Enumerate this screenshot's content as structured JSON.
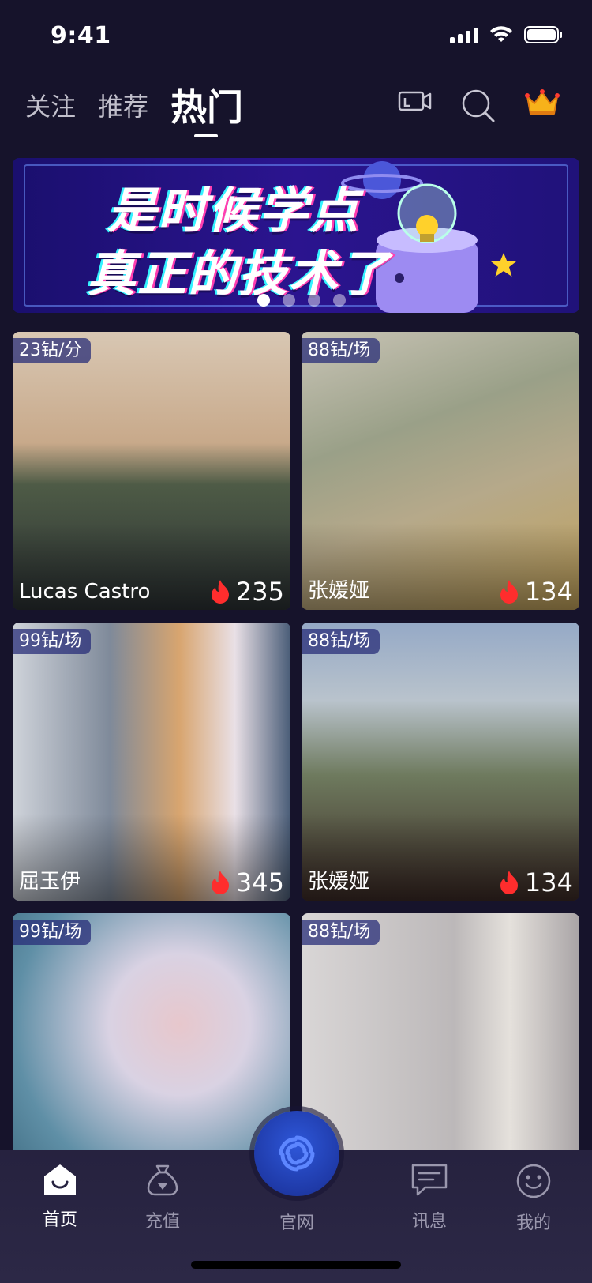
{
  "status_bar": {
    "time": "9:41"
  },
  "top_nav": {
    "tabs": [
      {
        "label": "关注",
        "active": false
      },
      {
        "label": "推荐",
        "active": false
      },
      {
        "label": "热门",
        "active": true
      }
    ],
    "icons": [
      "live-camera-icon",
      "search-icon",
      "crown-icon"
    ]
  },
  "banner": {
    "line1": "是时候学点",
    "line2": "真正的技术了",
    "page_count": 4,
    "active_index": 0
  },
  "cards": [
    {
      "price": "23钻/分",
      "name": "Lucas Castro",
      "heat": "235",
      "theme": [
        "#d8c7b3",
        "#8c7a6a",
        "#2b3133"
      ]
    },
    {
      "price": "88钻/场",
      "name": "张媛娅",
      "heat": "134",
      "theme": [
        "#b8b1a3",
        "#7c806c",
        "#c2a25a"
      ]
    },
    {
      "price": "99钻/场",
      "name": "屈玉伊",
      "heat": "345",
      "theme": [
        "#e8e7ea",
        "#9a8b7f",
        "#4a5d78"
      ]
    },
    {
      "price": "88钻/场",
      "name": "张媛娅",
      "heat": "134",
      "theme": [
        "#95a9c6",
        "#6d6a62",
        "#3c2a26"
      ]
    },
    {
      "price": "99钻/场",
      "name": "",
      "heat": "",
      "theme": [
        "#5f8fa6",
        "#d9d2e3",
        "#e7a7b8"
      ]
    },
    {
      "price": "88钻/场",
      "name": "",
      "heat": "",
      "theme": [
        "#d9d6d6",
        "#a9a4a6",
        "#1b1b1b"
      ]
    }
  ],
  "tab_bar": {
    "items": [
      {
        "label": "首页",
        "icon": "home-icon",
        "active": true
      },
      {
        "label": "充值",
        "icon": "money-bag-icon",
        "active": false
      },
      {
        "label": "官网",
        "icon": "site-logo-icon",
        "active": false
      },
      {
        "label": "讯息",
        "icon": "message-icon",
        "active": false
      },
      {
        "label": "我的",
        "icon": "profile-smile-icon",
        "active": false
      }
    ]
  },
  "colors": {
    "background": "#16132b",
    "accent_fire": "#ff2d2d",
    "price_tag": "#282d78"
  }
}
